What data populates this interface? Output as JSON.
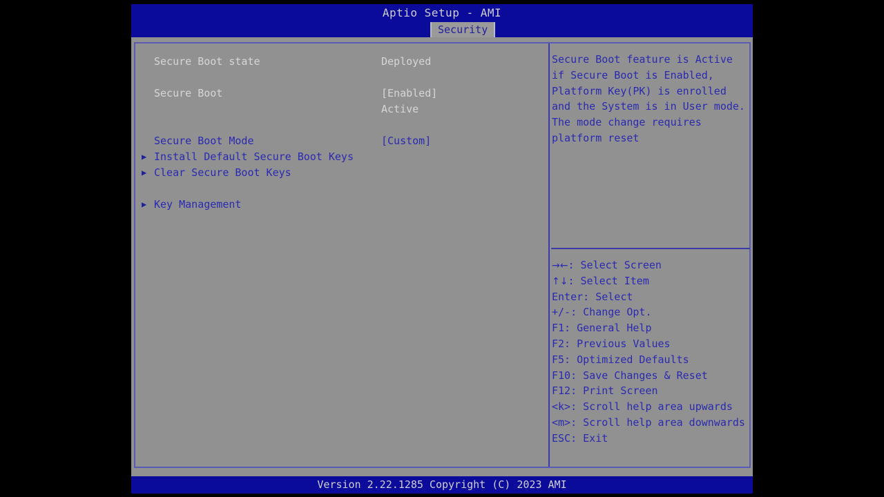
{
  "header": {
    "title": "Aptio Setup - AMI",
    "active_tab": "Security",
    "tabs": [
      "Security"
    ]
  },
  "settings": [
    {
      "label": "Secure Boot state",
      "value": "Deployed",
      "kind": "info",
      "arrow": ""
    },
    {
      "label": "Secure Boot",
      "value": "[Enabled]",
      "kind": "info",
      "arrow": ""
    },
    {
      "label": "",
      "value": "Active",
      "kind": "info",
      "arrow": ""
    },
    {
      "label": "Secure Boot Mode",
      "value": "[Custom]",
      "kind": "action",
      "arrow": ""
    },
    {
      "label": "Install Default Secure Boot Keys",
      "value": "",
      "kind": "action",
      "arrow": "▶"
    },
    {
      "label": "Clear Secure Boot Keys",
      "value": "",
      "kind": "action",
      "arrow": "▶"
    },
    {
      "label": "Key Management",
      "value": "",
      "kind": "action",
      "arrow": "▶"
    }
  ],
  "help": {
    "lines": [
      "Secure Boot feature is Active",
      "if Secure Boot is Enabled,",
      "Platform Key(PK) is enrolled",
      "and the System is in User mode.",
      "The mode change requires",
      "platform reset"
    ]
  },
  "keys": [
    {
      "glyph": "→←",
      "text": ": Select Screen"
    },
    {
      "glyph": "↑↓",
      "text": ": Select Item"
    },
    {
      "glyph": "",
      "text": "Enter: Select"
    },
    {
      "glyph": "",
      "text": "+/-: Change Opt."
    },
    {
      "glyph": "",
      "text": "F1: General Help"
    },
    {
      "glyph": "",
      "text": "F2: Previous Values"
    },
    {
      "glyph": "",
      "text": "F5: Optimized Defaults"
    },
    {
      "glyph": "",
      "text": "F10: Save Changes & Reset"
    },
    {
      "glyph": "",
      "text": "F12: Print Screen"
    },
    {
      "glyph": "",
      "text": "<k>: Scroll help area upwards"
    },
    {
      "glyph": "",
      "text": "<m>: Scroll help area downwards"
    },
    {
      "glyph": "",
      "text": "ESC: Exit"
    }
  ],
  "footer": {
    "version": "Version 2.22.1285 Copyright (C) 2023 AMI"
  },
  "colors": {
    "title_bar": "#0a0a9b",
    "panel_bg": "#919191",
    "border": "#5a5ab4",
    "action_text": "#2a2ab0",
    "info_text": "#d6d6d6",
    "tab_bg": "#9a9a9a"
  }
}
